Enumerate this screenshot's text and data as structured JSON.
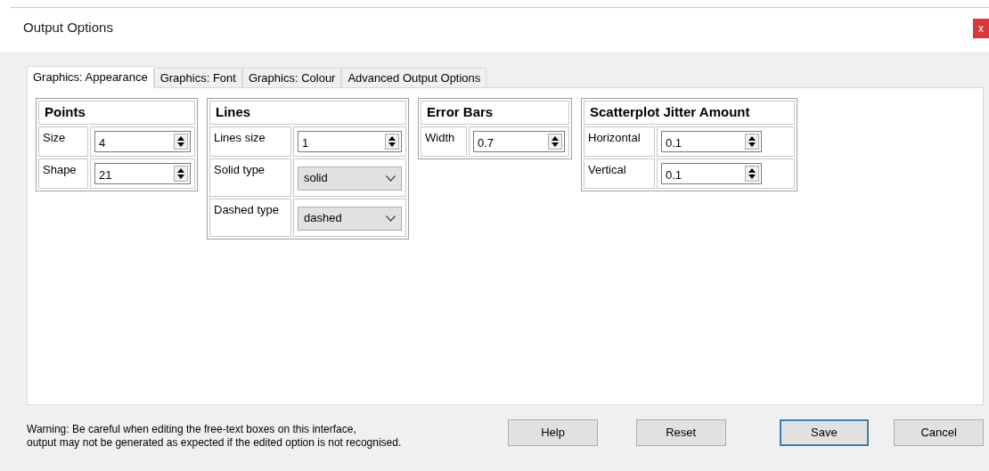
{
  "window": {
    "title": "Output Options",
    "close": "x"
  },
  "tabs": [
    {
      "label": "Graphics: Appearance",
      "selected": true
    },
    {
      "label": "Graphics: Font",
      "selected": false
    },
    {
      "label": "Graphics: Colour",
      "selected": false
    },
    {
      "label": "Advanced Output Options",
      "selected": false
    }
  ],
  "groups": [
    {
      "heading": "Points",
      "rows": [
        {
          "kind": "spin",
          "label": "Size",
          "value": "4"
        },
        {
          "kind": "spin",
          "label": "Shape",
          "value": "21"
        }
      ]
    },
    {
      "heading": "Lines",
      "rows": [
        {
          "kind": "spin",
          "label": "Lines size",
          "value": "1"
        },
        {
          "kind": "select",
          "label": "Solid type",
          "value": "solid"
        },
        {
          "kind": "select",
          "label": "Dashed type",
          "value": "dashed"
        }
      ]
    },
    {
      "heading": "Error Bars",
      "rows": [
        {
          "kind": "spin",
          "label": "Width",
          "value": "0.7"
        }
      ]
    },
    {
      "heading": "Scatterplot Jitter Amount",
      "rows": [
        {
          "kind": "spin",
          "label": "Horizontal",
          "value": "0.1"
        },
        {
          "kind": "spin",
          "label": "Vertical",
          "value": "0.1"
        }
      ]
    }
  ],
  "warning": [
    "Warning: Be careful when editing the free-text boxes on this interface,",
    "output may not be generated as expected if the edited option is not recognised."
  ],
  "buttons": [
    {
      "label": "Help",
      "default": false
    },
    {
      "label": "Reset",
      "default": false
    },
    {
      "label": "Save",
      "default": true
    },
    {
      "label": "Cancel",
      "default": false
    }
  ]
}
